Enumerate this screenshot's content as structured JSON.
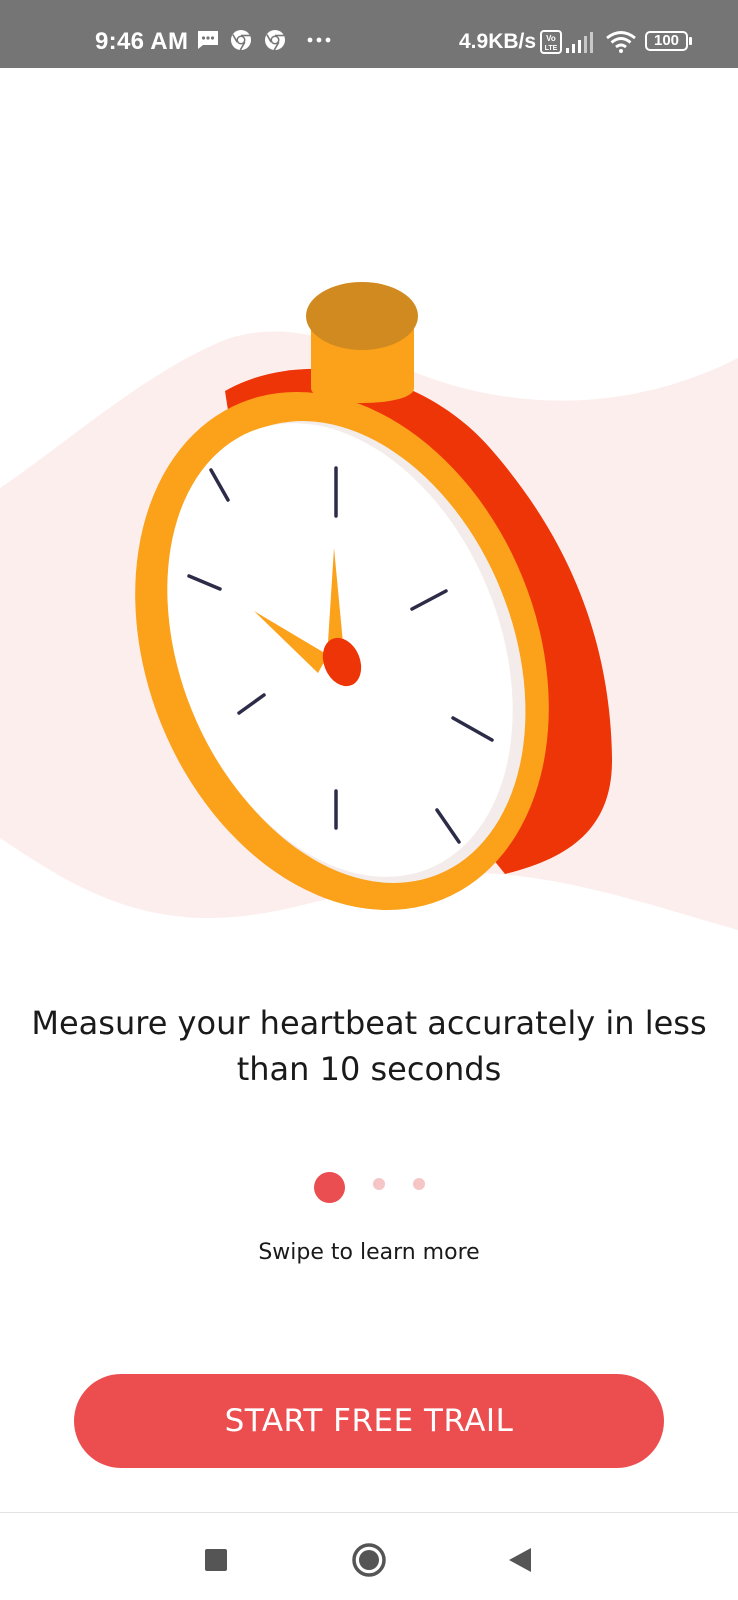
{
  "status_bar": {
    "time": "9:46 AM",
    "notification_icons": [
      "message-icon",
      "chrome-icon",
      "chrome-icon",
      "more-dots-icon"
    ],
    "network_speed": "4.9KB/s",
    "volte_label": "Vo LTE",
    "battery": "100"
  },
  "onboarding": {
    "headline": "Measure your heartbeat accurately in less than 10 seconds",
    "page_indicator": {
      "total": 3,
      "active": 1
    },
    "swipe_hint": "Swipe to learn more",
    "cta_label": "START FREE TRAIL"
  },
  "illustration": {
    "subject": "stopwatch-icon"
  },
  "nav_bar": {
    "icons": [
      "recents-square-icon",
      "home-circle-icon",
      "back-triangle-icon"
    ]
  },
  "colors": {
    "accent": "#ec4d4f",
    "stopwatch_body": "#ee3507",
    "stopwatch_rim": "#fba11a",
    "stopwatch_button": "#d18a1f",
    "background_wave": "#fdeeee",
    "status_bar": "#757575"
  }
}
